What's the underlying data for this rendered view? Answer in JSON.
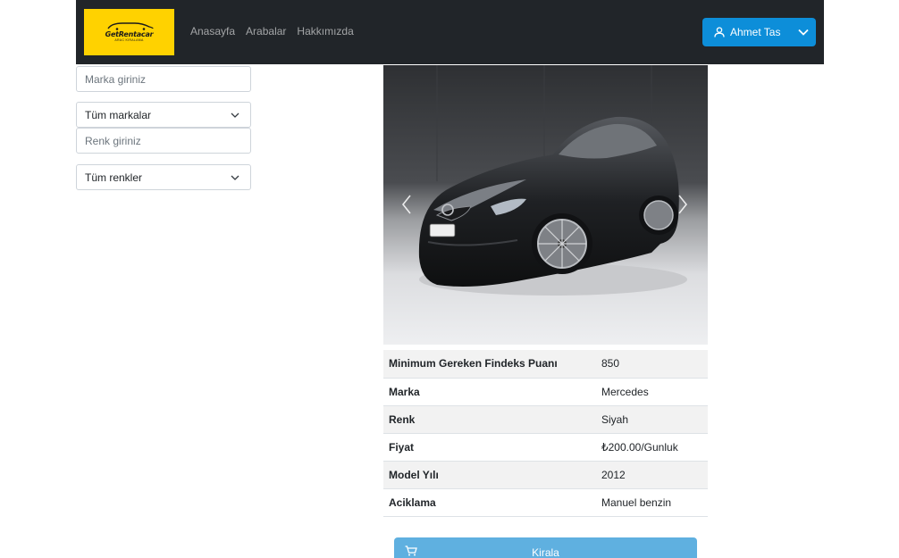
{
  "navbar": {
    "logo_text": "GetRentacar",
    "logo_sub": "ARAC KIRALAMA",
    "links": [
      "Anasayfa",
      "Arabalar",
      "Hakkımızda"
    ],
    "user_name": "Ahmet Tas"
  },
  "filters": {
    "brand_placeholder": "Marka giriniz",
    "brand_select": "Tüm markalar",
    "color_placeholder": "Renk giriniz",
    "color_select": "Tüm renkler"
  },
  "car_details": [
    {
      "label": "Minimum Gereken Findeks Puanı",
      "value": "850"
    },
    {
      "label": "Marka",
      "value": "Mercedes"
    },
    {
      "label": "Renk",
      "value": "Siyah"
    },
    {
      "label": "Fiyat",
      "value": "₺200.00/Gunluk"
    },
    {
      "label": "Model Yılı",
      "value": "2012"
    },
    {
      "label": "Aciklama",
      "value": "Manuel benzin"
    }
  ],
  "rent_button": "Kirala",
  "icons": {
    "user": "user-icon",
    "dropdown": "chevron-down-icon",
    "prev": "chevron-left-icon",
    "next": "chevron-right-icon",
    "cart": "cart-icon"
  },
  "colors": {
    "navbar_bg": "#212529",
    "logo_bg": "#ffd200",
    "user_button": "#0d8ed9",
    "rent_button": "#5fb0e0"
  }
}
